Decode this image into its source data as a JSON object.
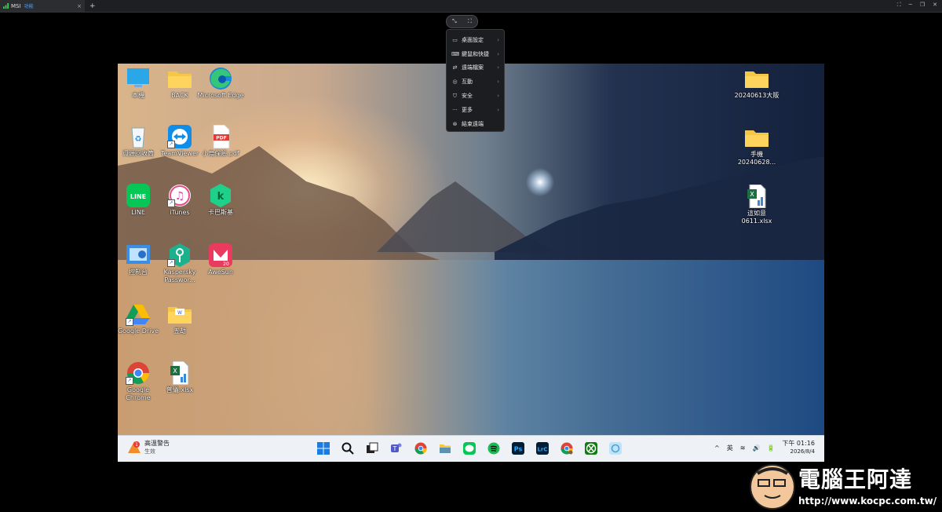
{
  "tab": {
    "title": "MSI",
    "subtitle": "功能",
    "close": "×",
    "new": "+"
  },
  "window_controls": [
    "⛶",
    "─",
    "❐",
    "✕"
  ],
  "remote_toolbar": {
    "pointer": "⤡",
    "fullscreen": "⛶"
  },
  "menu": [
    {
      "icon": "monitor-icon",
      "glyph": "▭",
      "label": "桌面設定",
      "chevron": "›"
    },
    {
      "icon": "keyboard-icon",
      "glyph": "⌨",
      "label": "鍵鼠和快捷",
      "chevron": "›"
    },
    {
      "icon": "file-transfer-icon",
      "glyph": "⇄",
      "label": "遠端檔案",
      "chevron": "›"
    },
    {
      "icon": "interaction-icon",
      "glyph": "◎",
      "label": "互動",
      "chevron": "›"
    },
    {
      "icon": "shield-icon",
      "glyph": "⛉",
      "label": "安全",
      "chevron": "›"
    },
    {
      "icon": "more-icon",
      "glyph": "···",
      "label": "更多",
      "chevron": "›"
    },
    {
      "icon": "end-session-icon",
      "glyph": "⊗",
      "label": "結束遠端",
      "chevron": ""
    }
  ],
  "desktop_icons": [
    {
      "name": "this-pc",
      "label": "本機"
    },
    {
      "name": "back-folder",
      "label": "BACK"
    },
    {
      "name": "microsoft-edge",
      "label": "Microsoft Edge"
    },
    {
      "name": "recycle-bin",
      "label": "資源回收筒"
    },
    {
      "name": "teamviewer",
      "label": "TeamViewer"
    },
    {
      "name": "pdf-file",
      "label": "小烏保險.pdf"
    },
    {
      "name": "line",
      "label": "LINE"
    },
    {
      "name": "itunes",
      "label": "iTunes"
    },
    {
      "name": "kaspersky",
      "label": "卡巴斯基"
    },
    {
      "name": "control-panel",
      "label": "控制台"
    },
    {
      "name": "kaspersky-password",
      "label": "Kaspersky Passwor..."
    },
    {
      "name": "awesun",
      "label": "AweSun"
    },
    {
      "name": "google-drive",
      "label": "Google Drive"
    },
    {
      "name": "wuhua-folder",
      "label": "五劫"
    },
    {
      "name": "google-chrome",
      "label": "Google Chrome"
    },
    {
      "name": "excel-file-left",
      "label": "普儀.xlsx"
    },
    {
      "name": "folder-20240613",
      "label": "20240613大阪"
    },
    {
      "name": "folder-phone",
      "label": "手機 20240628..."
    },
    {
      "name": "excel-file-right",
      "label": "這如意 0611.xlsx"
    }
  ],
  "taskbar": {
    "weather": {
      "badge": "1",
      "title": "高溫警告",
      "sub": "生效"
    },
    "tray": {
      "chevron": "^",
      "ime": "英",
      "wifi": "≋",
      "volume": "🔊",
      "battery": "🔋"
    },
    "time": "下午 01:16",
    "date": "2026/8/4"
  },
  "watermark": {
    "title": "電腦王阿達",
    "url": "http://www.kocpc.com.tw/"
  },
  "colors": {
    "menu_bg": "#1c1d20",
    "taskbar_bg": "#eef2f7",
    "accent": "#4aa3ff"
  }
}
